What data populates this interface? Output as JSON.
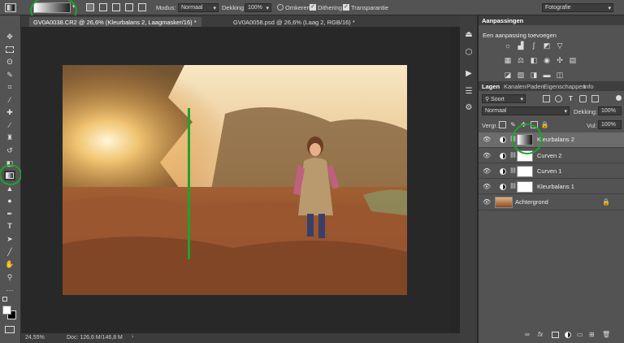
{
  "options_bar": {
    "mode_label": "Modus:",
    "mode_value": "Normaal",
    "opacity_label": "Dekking:",
    "opacity_value": "100%",
    "reverse_label": "Omkeren",
    "dither_label": "Dithering",
    "transparency_label": "Transparantie",
    "workspace_value": "Fotografie",
    "reverse_checked": false,
    "dither_checked": true,
    "transparency_checked": true
  },
  "documents": {
    "tabs": [
      {
        "label": "GV0A0038.CR2 @ 26,6% (Kleurbalans 2, Laagmasker/16) *"
      },
      {
        "label": "GV0A0058.psd @ 26,6% (Laag 2, RGB/16) *"
      }
    ]
  },
  "status": {
    "zoom": "24,55%",
    "doc": "Doc: 126,6 M/146,8 M"
  },
  "adjustments": {
    "title": "Aanpassingen",
    "subtitle": "Een aanpassing toevoegen"
  },
  "layers_panel": {
    "tabs": [
      "Lagen",
      "Kanalen",
      "Paden",
      "Eigenschappen",
      "Info"
    ],
    "filter_label": "Soort",
    "blend_mode": "Normaal",
    "opacity_label": "Dekking:",
    "opacity_value": "100%",
    "lock_label": "Vergr.:",
    "fill_label": "Vul:",
    "fill_value": "100%",
    "layers": [
      {
        "name": "Kleurbalans 2",
        "selected": true
      },
      {
        "name": "Curven 2",
        "selected": false
      },
      {
        "name": "Curven 1",
        "selected": false
      },
      {
        "name": "Kleurbalans 1",
        "selected": false
      },
      {
        "name": "Achtergrond",
        "selected": false
      }
    ]
  },
  "colors": {
    "annotation_green": "#1fa32b",
    "panel_bg": "#535353",
    "canvas_bg": "#282828"
  }
}
